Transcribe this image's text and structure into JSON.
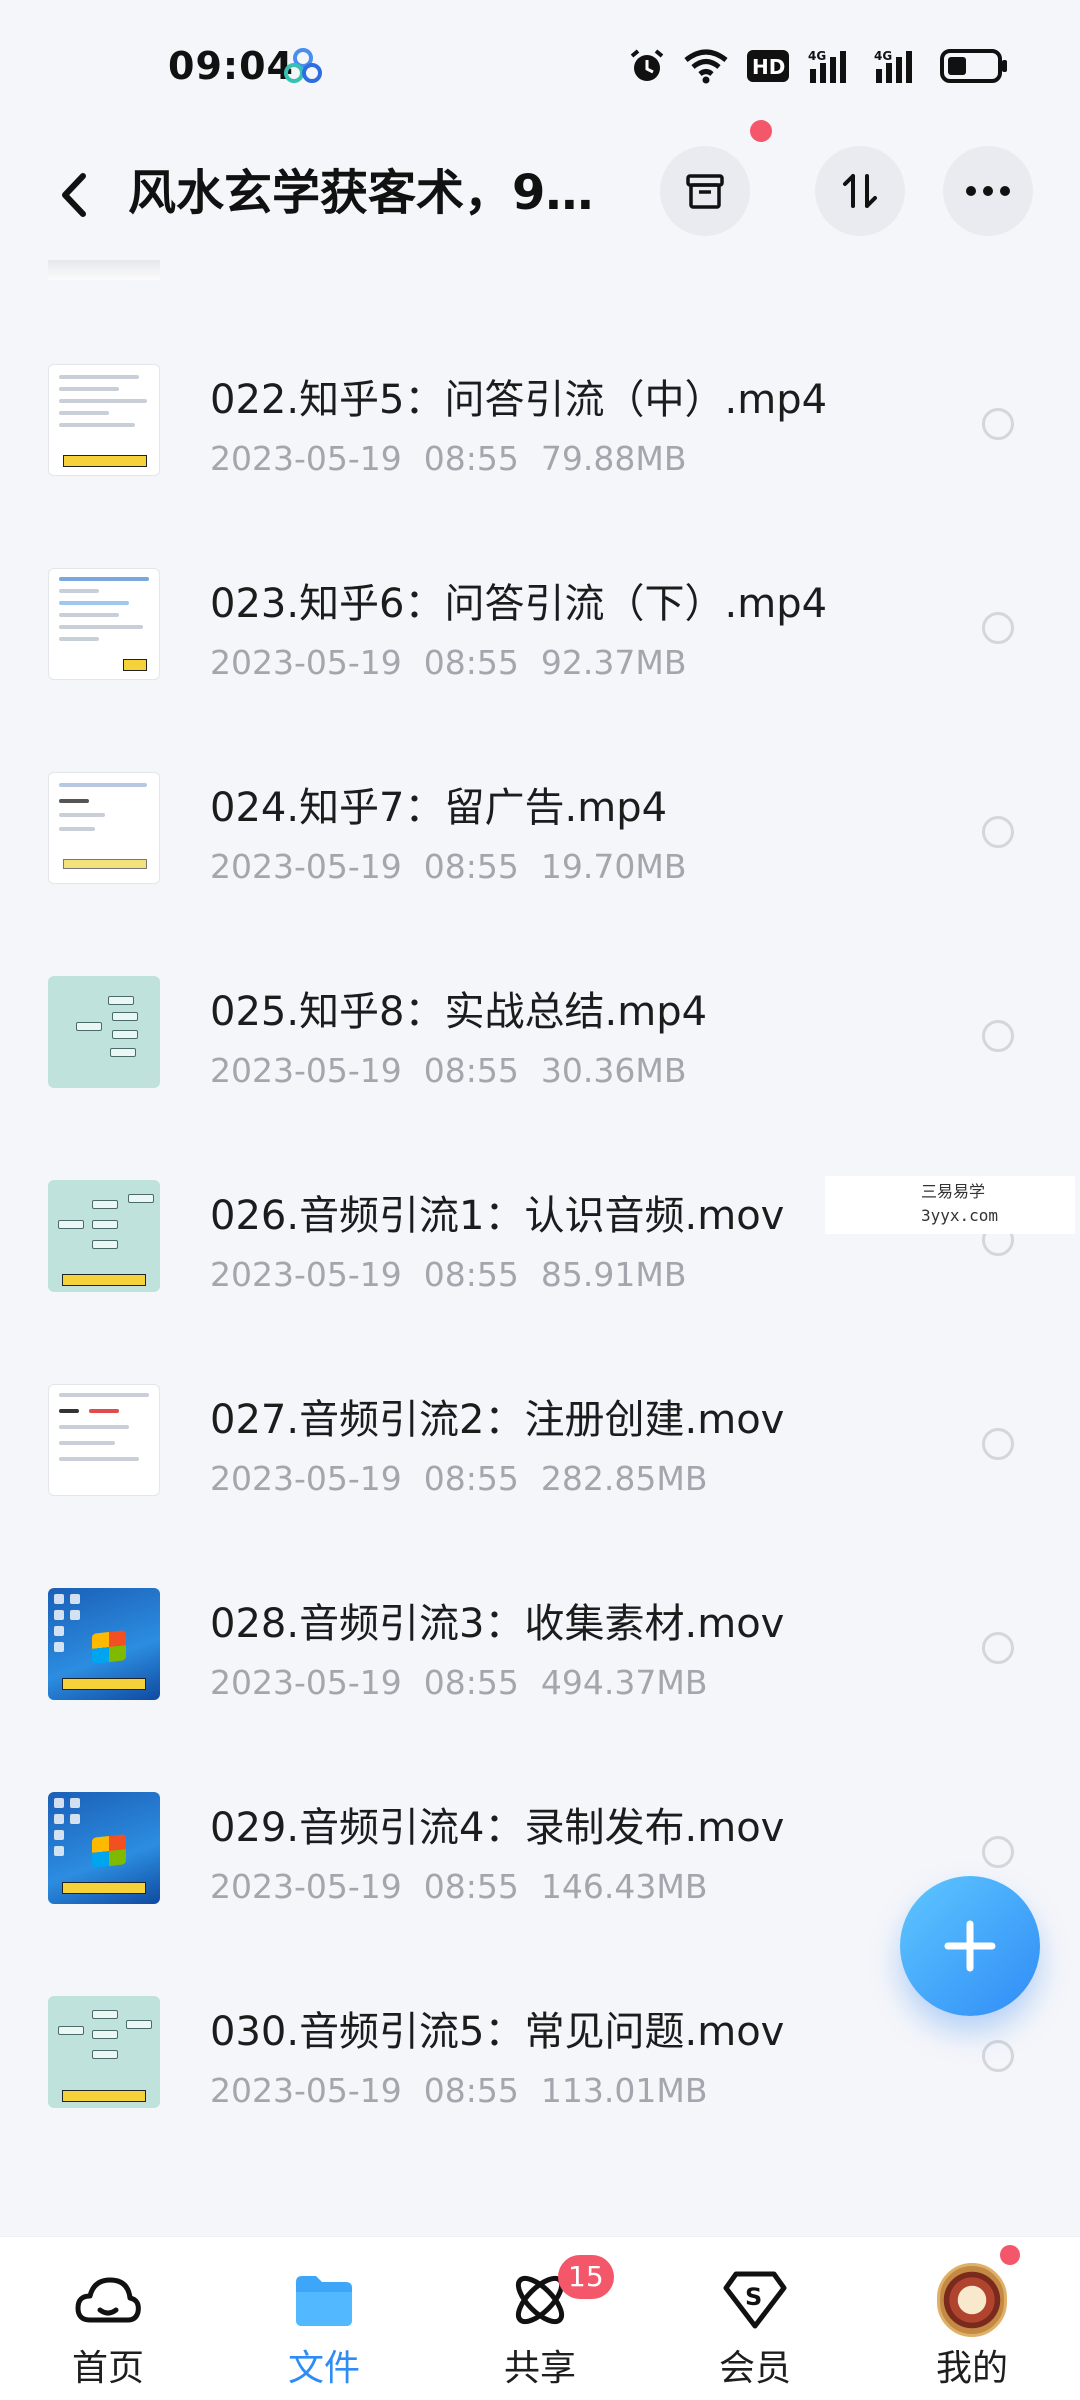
{
  "status_bar": {
    "time": "09:04",
    "battery_level": 0.4,
    "icons": [
      "app-notification-icon",
      "alarm-icon",
      "wifi-icon",
      "hd-icon",
      "signal-4g-icon",
      "signal-4g-icon",
      "battery-icon"
    ]
  },
  "header": {
    "title": "风水玄学获客术，9..."
  },
  "files": [
    {
      "name": "022.知乎5：问答引流（中）.mp4",
      "date": "2023-05-19",
      "time": "08:55",
      "size": "79.88MB",
      "thumb": "doc"
    },
    {
      "name": "023.知乎6：问答引流（下）.mp4",
      "date": "2023-05-19",
      "time": "08:55",
      "size": "92.37MB",
      "thumb": "doc"
    },
    {
      "name": "024.知乎7：留广告.mp4",
      "date": "2023-05-19",
      "time": "08:55",
      "size": "19.70MB",
      "thumb": "doc"
    },
    {
      "name": "025.知乎8：实战总结.mp4",
      "date": "2023-05-19",
      "time": "08:55",
      "size": "30.36MB",
      "thumb": "mind"
    },
    {
      "name": "026.音频引流1：认识音频.mov",
      "date": "2023-05-19",
      "time": "08:55",
      "size": "85.91MB",
      "thumb": "mind"
    },
    {
      "name": "027.音频引流2：注册创建.mov",
      "date": "2023-05-19",
      "time": "08:55",
      "size": "282.85MB",
      "thumb": "doc"
    },
    {
      "name": "028.音频引流3：收集素材.mov",
      "date": "2023-05-19",
      "time": "08:55",
      "size": "494.37MB",
      "thumb": "desk"
    },
    {
      "name": "029.音频引流4：录制发布.mov",
      "date": "2023-05-19",
      "time": "08:55",
      "size": "146.43MB",
      "thumb": "desk"
    },
    {
      "name": "030.音频引流5：常见问题.mov",
      "date": "2023-05-19",
      "time": "08:55",
      "size": "113.01MB",
      "thumb": "mind"
    }
  ],
  "watermark": {
    "line1": "三易易学",
    "line2": "3yyx.com"
  },
  "bottom_nav": {
    "items": [
      {
        "label": "首页",
        "icon": "home-cloud-icon"
      },
      {
        "label": "文件",
        "icon": "folder-icon"
      },
      {
        "label": "共享",
        "icon": "share-atom-icon",
        "badge": "15"
      },
      {
        "label": "会员",
        "icon": "vip-diamond-icon"
      },
      {
        "label": "我的",
        "icon": "avatar"
      }
    ],
    "active": "文件"
  },
  "colors": {
    "accent": "#2f8cf6",
    "badge": "#f4566a",
    "background": "#f5f6fa",
    "meta_text": "#a3a6ad"
  }
}
